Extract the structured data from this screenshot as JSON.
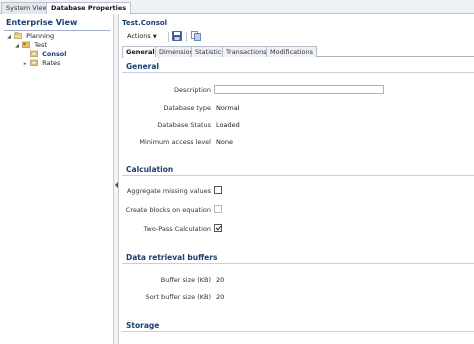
{
  "top_tabs": [
    {
      "label": "System View"
    },
    {
      "label": "Database Properties"
    }
  ],
  "left": {
    "title": "Enterprise View",
    "tree": [
      {
        "label": "Planning"
      },
      {
        "label": "Test"
      },
      {
        "label": "Consol"
      },
      {
        "label": "Rates"
      }
    ]
  },
  "main": {
    "object_title": "Test.Consol",
    "toolbar": {
      "actions_label": "Actions",
      "save_icon": "save-icon",
      "copy_icon": "copy-icon"
    },
    "tabs": [
      {
        "label": "General"
      },
      {
        "label": "Dimension"
      },
      {
        "label": "Statistics"
      },
      {
        "label": "Transactions"
      },
      {
        "label": "Modifications"
      }
    ],
    "general": {
      "title": "General",
      "description_label": "Description",
      "description_value": "",
      "db_type_label": "Database type",
      "db_type_value": "Normal",
      "db_status_label": "Database Status",
      "db_status_value": "Loaded",
      "min_access_label": "Minimum access level",
      "min_access_value": "None"
    },
    "calculation": {
      "title": "Calculation",
      "aggregate_label": "Aggregate missing values",
      "aggregate_checked": false,
      "create_blocks_label": "Create blocks on equation",
      "create_blocks_checked": false,
      "two_pass_label": "Two-Pass Calculation",
      "two_pass_checked": true
    },
    "retrieval": {
      "title": "Data retrieval buffers",
      "buffer_label": "Buffer size (KB)",
      "buffer_value": "20",
      "sort_buffer_label": "Sort buffer size (KB)",
      "sort_buffer_value": "20"
    },
    "storage": {
      "title": "Storage"
    }
  },
  "colors": {
    "accent_text": "#1b3e6f",
    "tab_bg": "#eef1f5",
    "border": "#b9c3cf"
  }
}
